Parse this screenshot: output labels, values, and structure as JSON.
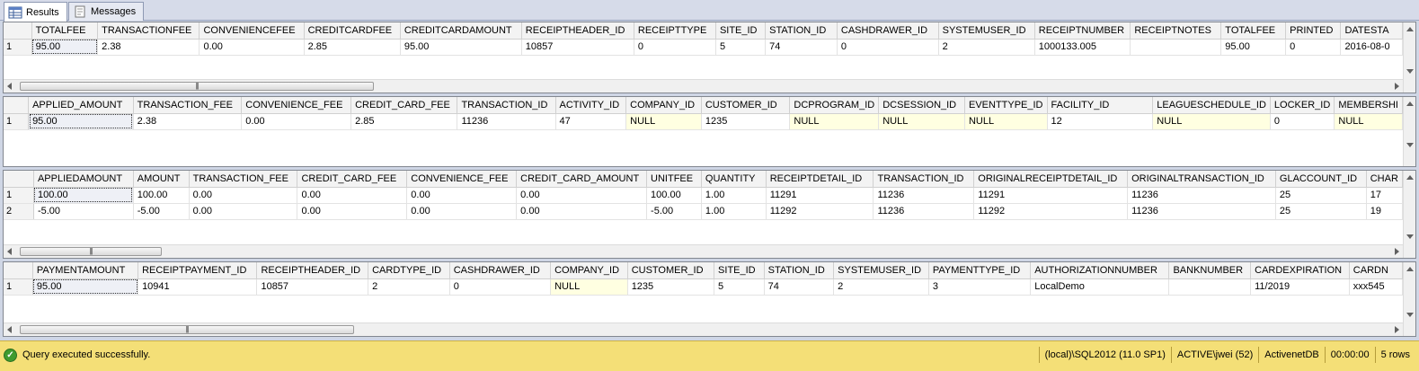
{
  "tabs": {
    "results": "Results",
    "messages": "Messages"
  },
  "grid1": {
    "columns": [
      "TOTALFEE",
      "TRANSACTIONFEE",
      "CONVENIENCEFEE",
      "CREDITCARDFEE",
      "CREDITCARDAMOUNT",
      "RECEIPTHEADER_ID",
      "RECEIPTTYPE",
      "SITE_ID",
      "STATION_ID",
      "CASHDRAWER_ID",
      "SYSTEMUSER_ID",
      "RECEIPTNUMBER",
      "RECEIPTNOTES",
      "TOTALFEE",
      "PRINTED",
      "DATESTA"
    ],
    "rows": [
      {
        "num": "1",
        "cells": [
          "95.00",
          "2.38",
          "0.00",
          "2.85",
          "95.00",
          "10857",
          "0",
          "5",
          "74",
          "0",
          "2",
          "1000133.005",
          "",
          "95.00",
          "0",
          "2016-08-0"
        ]
      }
    ]
  },
  "grid2": {
    "columns": [
      "APPLIED_AMOUNT",
      "TRANSACTION_FEE",
      "CONVENIENCE_FEE",
      "CREDIT_CARD_FEE",
      "TRANSACTION_ID",
      "ACTIVITY_ID",
      "COMPANY_ID",
      "CUSTOMER_ID",
      "DCPROGRAM_ID",
      "DCSESSION_ID",
      "EVENTTYPE_ID",
      "FACILITY_ID",
      "LEAGUESCHEDULE_ID",
      "LOCKER_ID",
      "MEMBERSHI"
    ],
    "rows": [
      {
        "num": "1",
        "cells": [
          "95.00",
          "2.38",
          "0.00",
          "2.85",
          "11236",
          "47",
          "NULL",
          "1235",
          "NULL",
          "NULL",
          "NULL",
          "12",
          "NULL",
          "0",
          "NULL"
        ]
      }
    ]
  },
  "grid3": {
    "columns": [
      "APPLIEDAMOUNT",
      "AMOUNT",
      "TRANSACTION_FEE",
      "CREDIT_CARD_FEE",
      "CONVENIENCE_FEE",
      "CREDIT_CARD_AMOUNT",
      "UNITFEE",
      "QUANTITY",
      "RECEIPTDETAIL_ID",
      "TRANSACTION_ID",
      "ORIGINALRECEIPTDETAIL_ID",
      "ORIGINALTRANSACTION_ID",
      "GLACCOUNT_ID",
      "CHAR"
    ],
    "rows": [
      {
        "num": "1",
        "cells": [
          "100.00",
          "100.00",
          "0.00",
          "0.00",
          "0.00",
          "0.00",
          "100.00",
          "1.00",
          "11291",
          "11236",
          "11291",
          "11236",
          "25",
          "17"
        ]
      },
      {
        "num": "2",
        "cells": [
          "-5.00",
          "-5.00",
          "0.00",
          "0.00",
          "0.00",
          "0.00",
          "-5.00",
          "1.00",
          "11292",
          "11236",
          "11292",
          "11236",
          "25",
          "19"
        ]
      }
    ]
  },
  "grid4": {
    "columns": [
      "PAYMENTAMOUNT",
      "RECEIPTPAYMENT_ID",
      "RECEIPTHEADER_ID",
      "CARDTYPE_ID",
      "CASHDRAWER_ID",
      "COMPANY_ID",
      "CUSTOMER_ID",
      "SITE_ID",
      "STATION_ID",
      "SYSTEMUSER_ID",
      "PAYMENTTYPE_ID",
      "AUTHORIZATIONNUMBER",
      "BANKNUMBER",
      "CARDEXPIRATION",
      "CARDN"
    ],
    "rows": [
      {
        "num": "1",
        "cells": [
          "95.00",
          "10941",
          "10857",
          "2",
          "0",
          "NULL",
          "1235",
          "5",
          "74",
          "2",
          "3",
          "LocalDemo",
          "",
          "11/2019",
          "xxx545"
        ]
      }
    ]
  },
  "status": {
    "message": "Query executed successfully.",
    "server": "(local)\\SQL2012 (11.0 SP1)",
    "user": "ACTIVE\\jwei (52)",
    "database": "ActivenetDB",
    "elapsed": "00:00:00",
    "rows": "5 rows"
  },
  "colors": {
    "status_bg": "#f4df77",
    "null_bg": "#ffffe1"
  }
}
